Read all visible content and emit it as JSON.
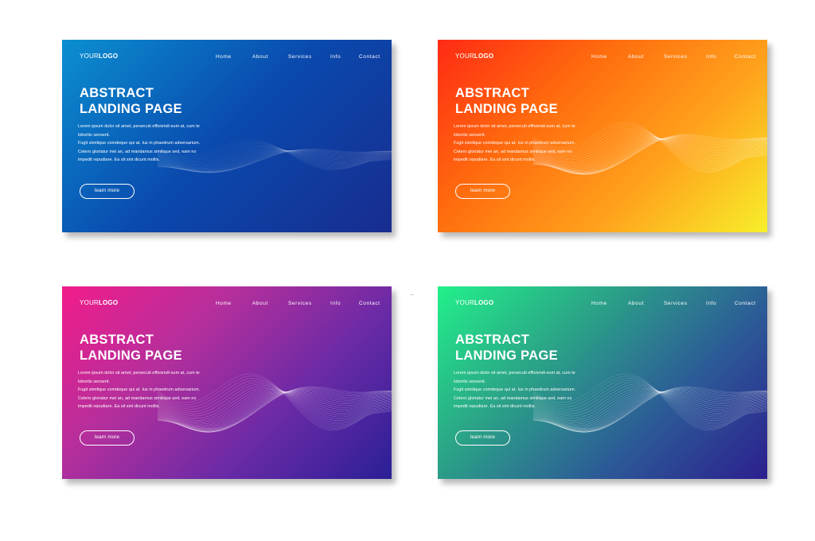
{
  "cards": [
    {
      "theme": "blue",
      "gradient": {
        "stops": [
          "#0b8fd1",
          "#0a49ad",
          "#182c8f"
        ],
        "angle": "135deg"
      },
      "logo": {
        "part_a": "YOUR",
        "part_b": "LOGO"
      },
      "nav": [
        "Home",
        "About",
        "Services",
        "Info",
        "Contact"
      ],
      "title": {
        "line1": "ABSTRACT",
        "line2": "LANDING PAGE"
      },
      "body": [
        "Lorem ipsum dolor sit amet, persecuti efficiendi eum at, cum te",
        "lobortis senserit.",
        "Fugit similique comdeque qui at. Ius in phaedrum adversarium.",
        "Cetero gloriatur mei an, ad mandamus similique sed, eam no",
        "impedit repudiare. Ea sit sint dicunt mollis."
      ],
      "button": "learn more"
    },
    {
      "theme": "orange",
      "gradient": {
        "stops": [
          "#ff2a14",
          "#ff6b0e",
          "#ffa21c",
          "#f7ef2a"
        ],
        "angle": "135deg"
      },
      "logo": {
        "part_a": "YOUR",
        "part_b": "LOGO"
      },
      "nav": [
        "Home",
        "About",
        "Services",
        "Info",
        "Contact"
      ],
      "title": {
        "line1": "ABSTRACT",
        "line2": "LANDING PAGE"
      },
      "body": [
        "Lorem ipsum dolor sit amet, persecuti efficiendi eum at, cum te",
        "lobortis senserit.",
        "Fugit similique comdeque qui at. Ius in phaedrum adversarium.",
        "Cetero gloriatur mei an, ad mandamus similique sed, eam no",
        "impedit repudiare. Ea sit sint dicunt mollis."
      ],
      "button": "learn more"
    },
    {
      "theme": "magenta",
      "gradient": {
        "stops": [
          "#f21c8a",
          "#b52f9c",
          "#6a2aa6",
          "#2a1f96"
        ],
        "angle": "135deg"
      },
      "logo": {
        "part_a": "YOUR",
        "part_b": "LOGO"
      },
      "nav": [
        "Home",
        "About",
        "Services",
        "Info",
        "Contact"
      ],
      "title": {
        "line1": "ABSTRACT",
        "line2": "LANDING PAGE"
      },
      "body": [
        "Lorem ipsum dolor sit amet, persecuti efficiendi eum at, cum te",
        "lobortis senserit.",
        "Fugit similique comdeque qui at. Ius in phaedrum adversarium.",
        "Cetero gloriatur mei an, ad mandamus similique sed, eam no",
        "impedit repudiare. Ea sit sint dicunt mollis."
      ],
      "button": "learn more"
    },
    {
      "theme": "green",
      "gradient": {
        "stops": [
          "#22f08a",
          "#2ba487",
          "#2c5b97",
          "#2c1f8e"
        ],
        "angle": "135deg"
      },
      "logo": {
        "part_a": "YOUR",
        "part_b": "LOGO"
      },
      "nav": [
        "Home",
        "About",
        "Services",
        "Info",
        "Contact"
      ],
      "title": {
        "line1": "ABSTRACT",
        "line2": "LANDING PAGE"
      },
      "body": [
        "Lorem ipsum dolor sit amet, persecuti efficiendi eum at, cum te",
        "lobortis senserit.",
        "Fugit similique comdeque qui at. Ius in phaedrum adversarium.",
        "Cetero gloriatur mei an, ad mandamus similique sed, eam no",
        "impedit repudiare. Ea sit sint dicunt mollis."
      ],
      "button": "learn more"
    }
  ]
}
